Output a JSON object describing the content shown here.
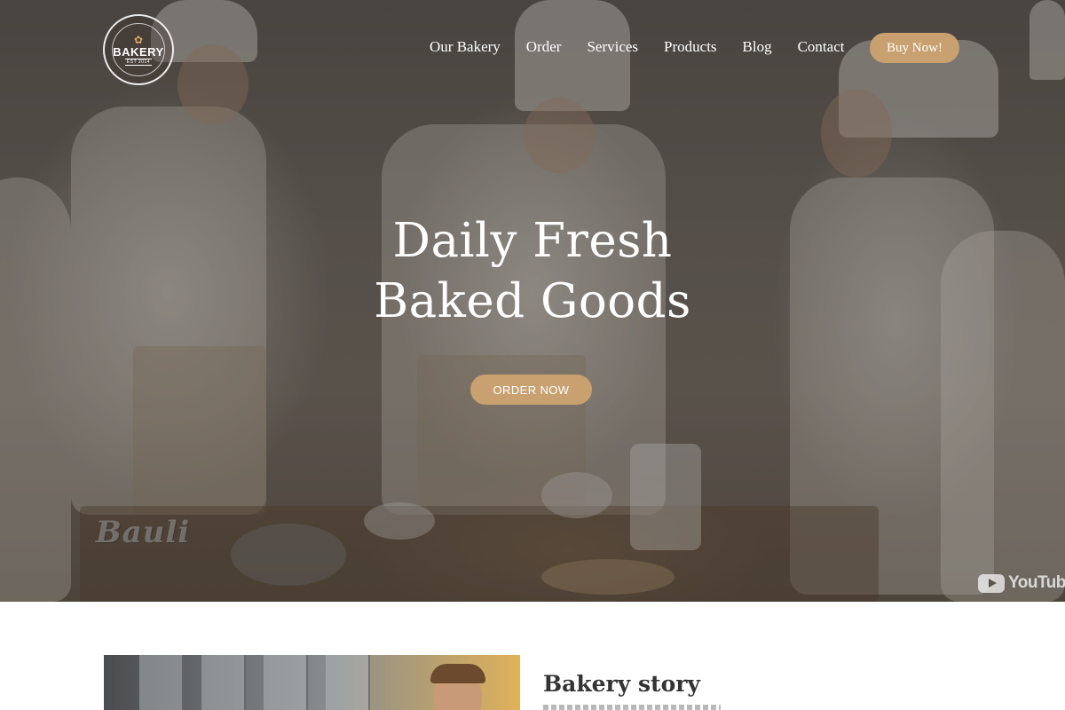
{
  "brand": {
    "logo_name": "BAKERY",
    "logo_est": "EST 2014",
    "logo_ring_text": "PREMIUM WORDPRESS BAKERY THEME",
    "logo_icon": "pretzel-icon"
  },
  "nav": {
    "items": [
      "Our Bakery",
      "Order",
      "Services",
      "Products",
      "Blog",
      "Contact"
    ],
    "buy_label": "Buy Now!"
  },
  "hero": {
    "headline_line1": "Daily Fresh",
    "headline_line2": "Baked Goods",
    "cta_label": "ORDER NOW",
    "video_watermark": "YouTube",
    "video_brand": "Bauli"
  },
  "story": {
    "title": "Bakery story"
  },
  "colors": {
    "accent": "#c9a171",
    "text_light": "#ffffff",
    "text_dark": "#333333"
  }
}
